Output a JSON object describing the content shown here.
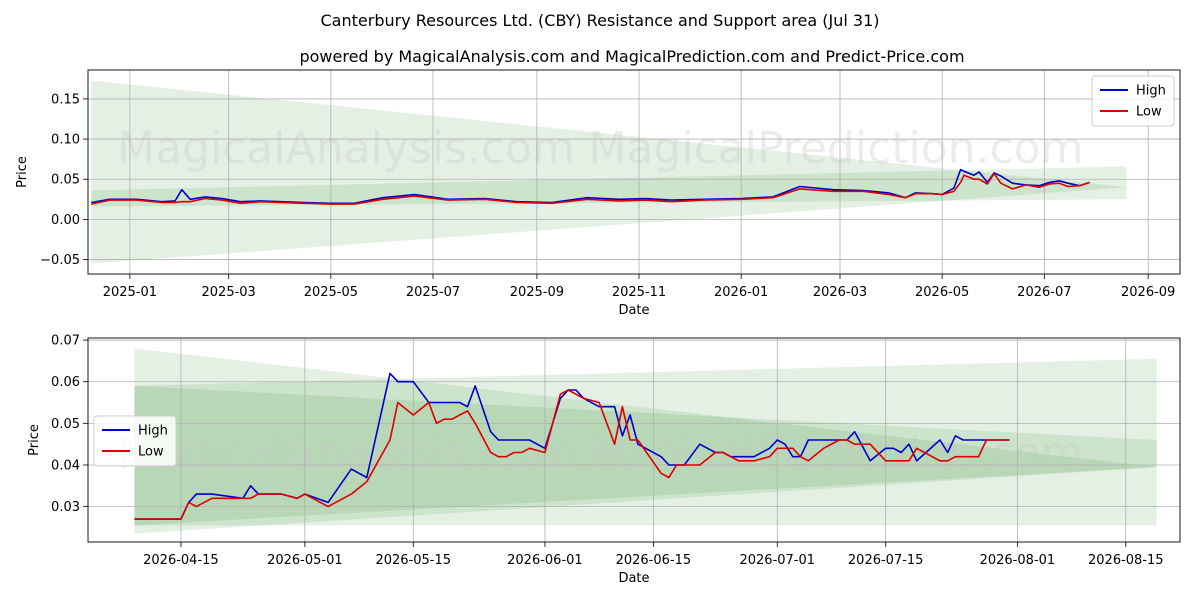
{
  "title": "Canterbury Resources Ltd. (CBY) Resistance and Support area (Jul 31)",
  "subtitle": "powered by MagicalAnalysis.com and MagicalPrediction.com and Predict-Price.com",
  "watermarks": [
    "MagicalAnalysis.com",
    "MagicalPrediction.com"
  ],
  "colors": {
    "high": "#0000cc",
    "low": "#dd0000",
    "band": "#2e8b2e",
    "grid": "#b0b0b0"
  },
  "chart_data": [
    {
      "type": "line",
      "xlabel": "Date",
      "ylabel": "Price",
      "xlim": [
        "2024-12-07",
        "2026-09-20"
      ],
      "ylim": [
        -0.068,
        0.186
      ],
      "x_ticks": [
        "2025-01",
        "2025-03",
        "2025-05",
        "2025-07",
        "2025-09",
        "2025-11",
        "2026-01",
        "2026-03",
        "2026-05",
        "2026-07",
        "2026-09"
      ],
      "y_ticks": [
        -0.05,
        0.0,
        0.05,
        0.1,
        0.15
      ],
      "y_tick_labels": [
        "−0.05",
        "0.00",
        "0.05",
        "0.10",
        "0.15"
      ],
      "grid": true,
      "legend": "top-right",
      "bands": [
        {
          "name": "",
          "x": [
            "2024-12-09",
            "2026-08-19"
          ],
          "upper": [
            0.173,
            0.04
          ],
          "lower": [
            -0.055,
            0.04
          ]
        },
        {
          "name": "",
          "x": [
            "2024-12-09",
            "2026-08-19"
          ],
          "upper": [
            0.036,
            0.066
          ],
          "lower": [
            0.016,
            0.025
          ]
        }
      ],
      "series": [
        {
          "name": "High",
          "x": [
            "2024-12-09",
            "2024-12-20",
            "2025-01-05",
            "2025-01-20",
            "2025-01-28",
            "2025-02-01",
            "2025-02-06",
            "2025-02-15",
            "2025-02-25",
            "2025-03-08",
            "2025-03-20",
            "2025-04-01",
            "2025-04-15",
            "2025-05-01",
            "2025-05-15",
            "2025-06-01",
            "2025-06-20",
            "2025-07-10",
            "2025-08-01",
            "2025-08-20",
            "2025-09-10",
            "2025-10-01",
            "2025-10-20",
            "2025-11-05",
            "2025-11-20",
            "2025-12-10",
            "2026-01-01",
            "2026-01-20",
            "2026-02-05",
            "2026-02-25",
            "2026-03-15",
            "2026-03-30",
            "2026-04-09",
            "2026-04-15",
            "2026-04-25",
            "2026-05-01",
            "2026-05-08",
            "2026-05-12",
            "2026-05-14",
            "2026-05-20",
            "2026-05-23",
            "2026-05-28",
            "2026-06-01",
            "2026-06-05",
            "2026-06-12",
            "2026-06-20",
            "2026-06-28",
            "2026-07-04",
            "2026-07-10",
            "2026-07-15",
            "2026-07-22",
            "2026-07-28"
          ],
          "values": [
            0.021,
            0.025,
            0.025,
            0.022,
            0.023,
            0.037,
            0.025,
            0.028,
            0.026,
            0.022,
            0.023,
            0.022,
            0.021,
            0.02,
            0.02,
            0.027,
            0.031,
            0.025,
            0.026,
            0.022,
            0.021,
            0.027,
            0.025,
            0.026,
            0.024,
            0.025,
            0.026,
            0.028,
            0.041,
            0.037,
            0.036,
            0.033,
            0.027,
            0.033,
            0.032,
            0.031,
            0.039,
            0.062,
            0.06,
            0.055,
            0.059,
            0.046,
            0.058,
            0.054,
            0.045,
            0.043,
            0.042,
            0.046,
            0.048,
            0.045,
            0.042,
            0.046
          ]
        },
        {
          "name": "Low",
          "x": [
            "2024-12-09",
            "2024-12-20",
            "2025-01-05",
            "2025-01-20",
            "2025-01-28",
            "2025-02-01",
            "2025-02-06",
            "2025-02-15",
            "2025-02-25",
            "2025-03-08",
            "2025-03-20",
            "2025-04-01",
            "2025-04-15",
            "2025-05-01",
            "2025-05-15",
            "2025-06-01",
            "2025-06-20",
            "2025-07-10",
            "2025-08-01",
            "2025-08-20",
            "2025-09-10",
            "2025-10-01",
            "2025-10-20",
            "2025-11-05",
            "2025-11-20",
            "2025-12-10",
            "2026-01-01",
            "2026-01-20",
            "2026-02-05",
            "2026-02-25",
            "2026-03-15",
            "2026-03-30",
            "2026-04-09",
            "2026-04-15",
            "2026-04-25",
            "2026-05-01",
            "2026-05-08",
            "2026-05-12",
            "2026-05-14",
            "2026-05-20",
            "2026-05-23",
            "2026-05-28",
            "2026-06-01",
            "2026-06-05",
            "2026-06-12",
            "2026-06-20",
            "2026-06-28",
            "2026-07-04",
            "2026-07-10",
            "2026-07-15",
            "2026-07-22",
            "2026-07-28"
          ],
          "values": [
            0.019,
            0.024,
            0.024,
            0.021,
            0.021,
            0.022,
            0.022,
            0.026,
            0.024,
            0.02,
            0.022,
            0.021,
            0.02,
            0.019,
            0.019,
            0.025,
            0.029,
            0.024,
            0.025,
            0.021,
            0.02,
            0.025,
            0.023,
            0.024,
            0.022,
            0.024,
            0.025,
            0.027,
            0.038,
            0.035,
            0.035,
            0.031,
            0.027,
            0.032,
            0.032,
            0.031,
            0.035,
            0.046,
            0.055,
            0.05,
            0.05,
            0.044,
            0.057,
            0.045,
            0.038,
            0.043,
            0.04,
            0.044,
            0.045,
            0.041,
            0.042,
            0.046
          ]
        }
      ]
    },
    {
      "type": "line",
      "xlabel": "Date",
      "ylabel": "Price",
      "xlim": [
        "2026-04-03",
        "2026-08-22"
      ],
      "ylim": [
        0.0215,
        0.0705
      ],
      "x_ticks": [
        "2026-04-15",
        "2026-05-01",
        "2026-05-15",
        "2026-06-01",
        "2026-06-15",
        "2026-07-01",
        "2026-07-15",
        "2026-08-01",
        "2026-08-15"
      ],
      "y_ticks": [
        0.03,
        0.04,
        0.05,
        0.06,
        0.07
      ],
      "y_tick_labels": [
        "0.03",
        "0.04",
        "0.05",
        "0.06",
        "0.07"
      ],
      "grid": true,
      "legend": "center-left",
      "bands": [
        {
          "name": "",
          "x": [
            "2026-04-09",
            "2026-08-19"
          ],
          "upper": [
            0.068,
            0.0395
          ],
          "lower": [
            0.0235,
            0.0395
          ]
        },
        {
          "name": "",
          "x": [
            "2026-04-09",
            "2026-08-19"
          ],
          "upper": [
            0.059,
            0.0655
          ],
          "lower": [
            0.0255,
            0.0255
          ]
        },
        {
          "name": "",
          "x": [
            "2026-04-09",
            "2026-08-19"
          ],
          "upper": [
            0.059,
            0.046
          ],
          "lower": [
            0.0255,
            0.0395
          ]
        }
      ],
      "series": [
        {
          "name": "High",
          "x": [
            "2026-04-09",
            "2026-04-15",
            "2026-04-16",
            "2026-04-17",
            "2026-04-19",
            "2026-04-23",
            "2026-04-24",
            "2026-04-25",
            "2026-04-28",
            "2026-04-30",
            "2026-05-01",
            "2026-05-04",
            "2026-05-07",
            "2026-05-09",
            "2026-05-12",
            "2026-05-13",
            "2026-05-15",
            "2026-05-17",
            "2026-05-18",
            "2026-05-19",
            "2026-05-20",
            "2026-05-21",
            "2026-05-22",
            "2026-05-23",
            "2026-05-25",
            "2026-05-26",
            "2026-05-27",
            "2026-05-28",
            "2026-05-29",
            "2026-05-30",
            "2026-06-01",
            "2026-06-03",
            "2026-06-04",
            "2026-06-05",
            "2026-06-06",
            "2026-06-08",
            "2026-06-10",
            "2026-06-11",
            "2026-06-12",
            "2026-06-13",
            "2026-06-16",
            "2026-06-17",
            "2026-06-18",
            "2026-06-19",
            "2026-06-21",
            "2026-06-23",
            "2026-06-24",
            "2026-06-25",
            "2026-06-26",
            "2026-06-28",
            "2026-06-30",
            "2026-07-01",
            "2026-07-02",
            "2026-07-03",
            "2026-07-04",
            "2026-07-05",
            "2026-07-07",
            "2026-07-09",
            "2026-07-10",
            "2026-07-11",
            "2026-07-13",
            "2026-07-15",
            "2026-07-16",
            "2026-07-17",
            "2026-07-18",
            "2026-07-19",
            "2026-07-22",
            "2026-07-23",
            "2026-07-24",
            "2026-07-25",
            "2026-07-27",
            "2026-07-28",
            "2026-07-29",
            "2026-07-30",
            "2026-07-31"
          ],
          "values": [
            0.027,
            0.027,
            0.031,
            0.033,
            0.033,
            0.032,
            0.035,
            0.033,
            0.033,
            0.032,
            0.033,
            0.031,
            0.039,
            0.037,
            0.062,
            0.06,
            0.06,
            0.055,
            0.055,
            0.055,
            0.055,
            0.055,
            0.054,
            0.059,
            0.048,
            0.046,
            0.046,
            0.046,
            0.046,
            0.046,
            0.044,
            0.056,
            0.058,
            0.058,
            0.056,
            0.054,
            0.054,
            0.047,
            0.052,
            0.045,
            0.042,
            0.04,
            0.04,
            0.04,
            0.045,
            0.043,
            0.043,
            0.042,
            0.042,
            0.042,
            0.044,
            0.046,
            0.045,
            0.042,
            0.042,
            0.046,
            0.046,
            0.046,
            0.046,
            0.048,
            0.041,
            0.044,
            0.044,
            0.043,
            0.045,
            0.041,
            0.046,
            0.043,
            0.047,
            0.046,
            0.046,
            0.046,
            0.046,
            0.046,
            0.046
          ]
        },
        {
          "name": "Low",
          "x": [
            "2026-04-09",
            "2026-04-15",
            "2026-04-16",
            "2026-04-17",
            "2026-04-19",
            "2026-04-23",
            "2026-04-24",
            "2026-04-25",
            "2026-04-28",
            "2026-04-30",
            "2026-05-01",
            "2026-05-04",
            "2026-05-07",
            "2026-05-09",
            "2026-05-12",
            "2026-05-13",
            "2026-05-15",
            "2026-05-17",
            "2026-05-18",
            "2026-05-19",
            "2026-05-20",
            "2026-05-21",
            "2026-05-22",
            "2026-05-23",
            "2026-05-25",
            "2026-05-26",
            "2026-05-27",
            "2026-05-28",
            "2026-05-29",
            "2026-05-30",
            "2026-06-01",
            "2026-06-03",
            "2026-06-04",
            "2026-06-05",
            "2026-06-06",
            "2026-06-08",
            "2026-06-10",
            "2026-06-11",
            "2026-06-12",
            "2026-06-13",
            "2026-06-16",
            "2026-06-17",
            "2026-06-18",
            "2026-06-19",
            "2026-06-21",
            "2026-06-23",
            "2026-06-24",
            "2026-06-25",
            "2026-06-26",
            "2026-06-28",
            "2026-06-30",
            "2026-07-01",
            "2026-07-02",
            "2026-07-03",
            "2026-07-04",
            "2026-07-05",
            "2026-07-07",
            "2026-07-09",
            "2026-07-10",
            "2026-07-11",
            "2026-07-13",
            "2026-07-15",
            "2026-07-16",
            "2026-07-17",
            "2026-07-18",
            "2026-07-19",
            "2026-07-22",
            "2026-07-23",
            "2026-07-24",
            "2026-07-25",
            "2026-07-27",
            "2026-07-28",
            "2026-07-29",
            "2026-07-30",
            "2026-07-31"
          ],
          "values": [
            0.027,
            0.027,
            0.031,
            0.03,
            0.032,
            0.032,
            0.032,
            0.033,
            0.033,
            0.032,
            0.033,
            0.03,
            0.033,
            0.036,
            0.046,
            0.055,
            0.052,
            0.055,
            0.05,
            0.051,
            0.051,
            0.052,
            0.053,
            0.05,
            0.043,
            0.042,
            0.042,
            0.043,
            0.043,
            0.044,
            0.043,
            0.057,
            0.058,
            0.057,
            0.056,
            0.055,
            0.045,
            0.054,
            0.046,
            0.046,
            0.038,
            0.037,
            0.04,
            0.04,
            0.04,
            0.043,
            0.043,
            0.042,
            0.041,
            0.041,
            0.042,
            0.044,
            0.044,
            0.044,
            0.042,
            0.041,
            0.044,
            0.046,
            0.046,
            0.045,
            0.045,
            0.041,
            0.041,
            0.041,
            0.041,
            0.044,
            0.041,
            0.041,
            0.042,
            0.042,
            0.042,
            0.046,
            0.046,
            0.046,
            0.046
          ]
        }
      ]
    }
  ]
}
